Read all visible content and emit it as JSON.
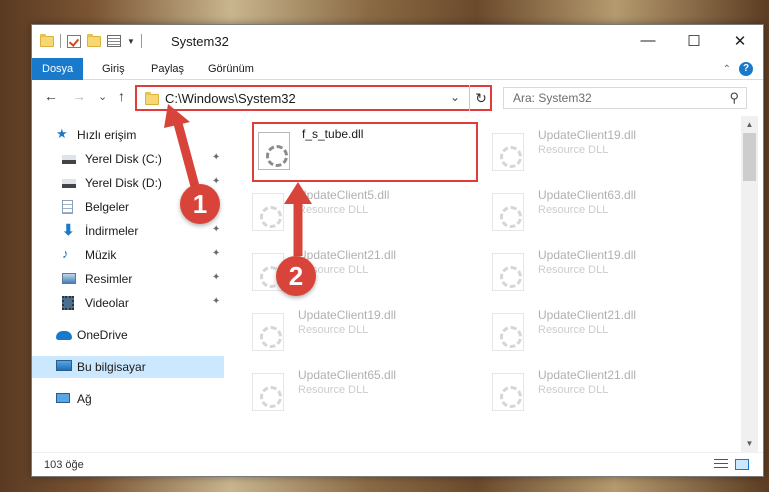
{
  "window": {
    "title": "System32",
    "controls": {
      "minimize": "—",
      "maximize": "☐",
      "close": "✕"
    }
  },
  "ribbon": {
    "tabs": [
      {
        "label": "Dosya",
        "active": true
      },
      {
        "label": "Giriş",
        "active": false
      },
      {
        "label": "Paylaş",
        "active": false
      },
      {
        "label": "Görünüm",
        "active": false
      }
    ],
    "expand_glyph": "⌃",
    "help_glyph": "?"
  },
  "nav": {
    "back": "←",
    "forward": "→",
    "recent": "⌄",
    "up": "↑",
    "address": "C:\\Windows\\System32",
    "address_dropdown": "⌄",
    "refresh": "↻",
    "search_placeholder": "Ara: System32",
    "search_glyph": "⚲"
  },
  "sidebar": {
    "pin_glyph": "📌",
    "items": [
      {
        "label": "Hızlı erişim",
        "icon": "star-icon",
        "pinned": false,
        "top": true
      },
      {
        "label": "Yerel Disk (C:)",
        "icon": "drive-icon",
        "pinned": true,
        "top": false
      },
      {
        "label": "Yerel Disk (D:)",
        "icon": "drive-icon",
        "pinned": true,
        "top": false
      },
      {
        "label": "Belgeler",
        "icon": "documents-icon",
        "pinned": true,
        "top": false
      },
      {
        "label": "İndirmeler",
        "icon": "download-icon",
        "pinned": true,
        "top": false
      },
      {
        "label": "Müzik",
        "icon": "music-icon",
        "pinned": true,
        "top": false
      },
      {
        "label": "Resimler",
        "icon": "pictures-icon",
        "pinned": true,
        "top": false
      },
      {
        "label": "Videolar",
        "icon": "videos-icon",
        "pinned": true,
        "top": false
      },
      {
        "label": "OneDrive",
        "icon": "cloud-icon",
        "pinned": false,
        "top": true
      },
      {
        "label": "Bu bilgisayar",
        "icon": "computer-icon",
        "pinned": false,
        "top": true,
        "selected": true
      },
      {
        "label": "Ağ",
        "icon": "network-icon",
        "pinned": false,
        "top": true
      }
    ]
  },
  "files": [
    {
      "name": "f_s_tube.dll",
      "type": "",
      "highlighted": true,
      "faded": false
    },
    {
      "name": "UpdateClient19.dll",
      "type": "Resource DLL",
      "highlighted": false,
      "faded": true
    },
    {
      "name": "UpdateClient5.dll",
      "type": "Resource DLL",
      "highlighted": false,
      "faded": true
    },
    {
      "name": "UpdateClient63.dll",
      "type": "Resource DLL",
      "highlighted": false,
      "faded": true
    },
    {
      "name": "UpdateClient21.dll",
      "type": "Resource DLL",
      "highlighted": false,
      "faded": true
    },
    {
      "name": "UpdateClient19.dll",
      "type": "Resource DLL",
      "highlighted": false,
      "faded": true
    },
    {
      "name": "UpdateClient19.dll",
      "type": "Resource DLL",
      "highlighted": false,
      "faded": true
    },
    {
      "name": "UpdateClient21.dll",
      "type": "Resource DLL",
      "highlighted": false,
      "faded": true
    },
    {
      "name": "UpdateClient65.dll",
      "type": "Resource DLL",
      "highlighted": false,
      "faded": true
    },
    {
      "name": "UpdateClient21.dll",
      "type": "Resource DLL",
      "highlighted": false,
      "faded": true
    }
  ],
  "status": {
    "item_count": "103 öğe"
  },
  "annotations": {
    "step1": "1",
    "step2": "2"
  },
  "colors": {
    "accent": "#1979ca",
    "annotation": "#e03c3c",
    "selected": "#cce8ff"
  }
}
